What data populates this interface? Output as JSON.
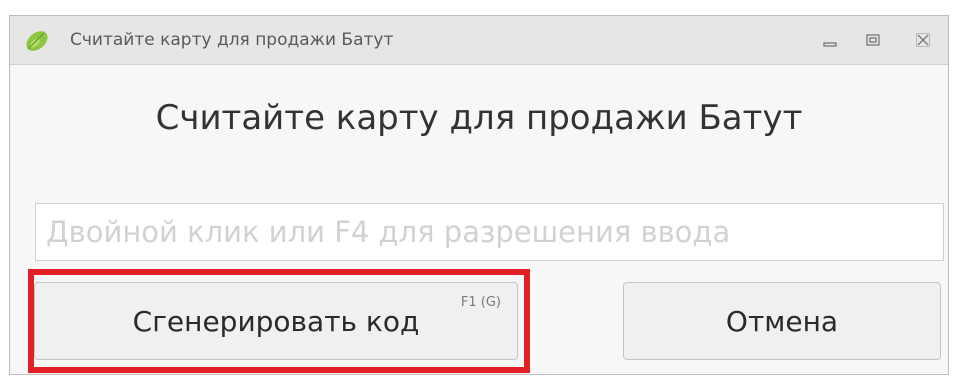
{
  "window": {
    "title": "Считайте карту для продажи Батут",
    "icon": "leaf-app-icon",
    "controls": {
      "minimize_icon": "minimize-icon",
      "maximize_icon": "maximize-icon",
      "close_icon": "close-icon"
    }
  },
  "dialog": {
    "heading": "Считайте карту для продажи Батут",
    "card_input": {
      "value": "",
      "placeholder": "Двойной клик или F4 для разрешения ввода"
    },
    "buttons": {
      "generate_label": "Сгенерировать код",
      "generate_hotkey": "F1 (G)",
      "cancel_label": "Отмена"
    }
  },
  "annotation": {
    "highlight_color": "#e31e24",
    "highlighted_element": "generate-code-button"
  },
  "colors": {
    "titlebar_bg": "#e6e6e6",
    "window_bg": "#f7f7f7",
    "button_bg": "#f0f0f0",
    "icon_green": "#8cc63f"
  }
}
